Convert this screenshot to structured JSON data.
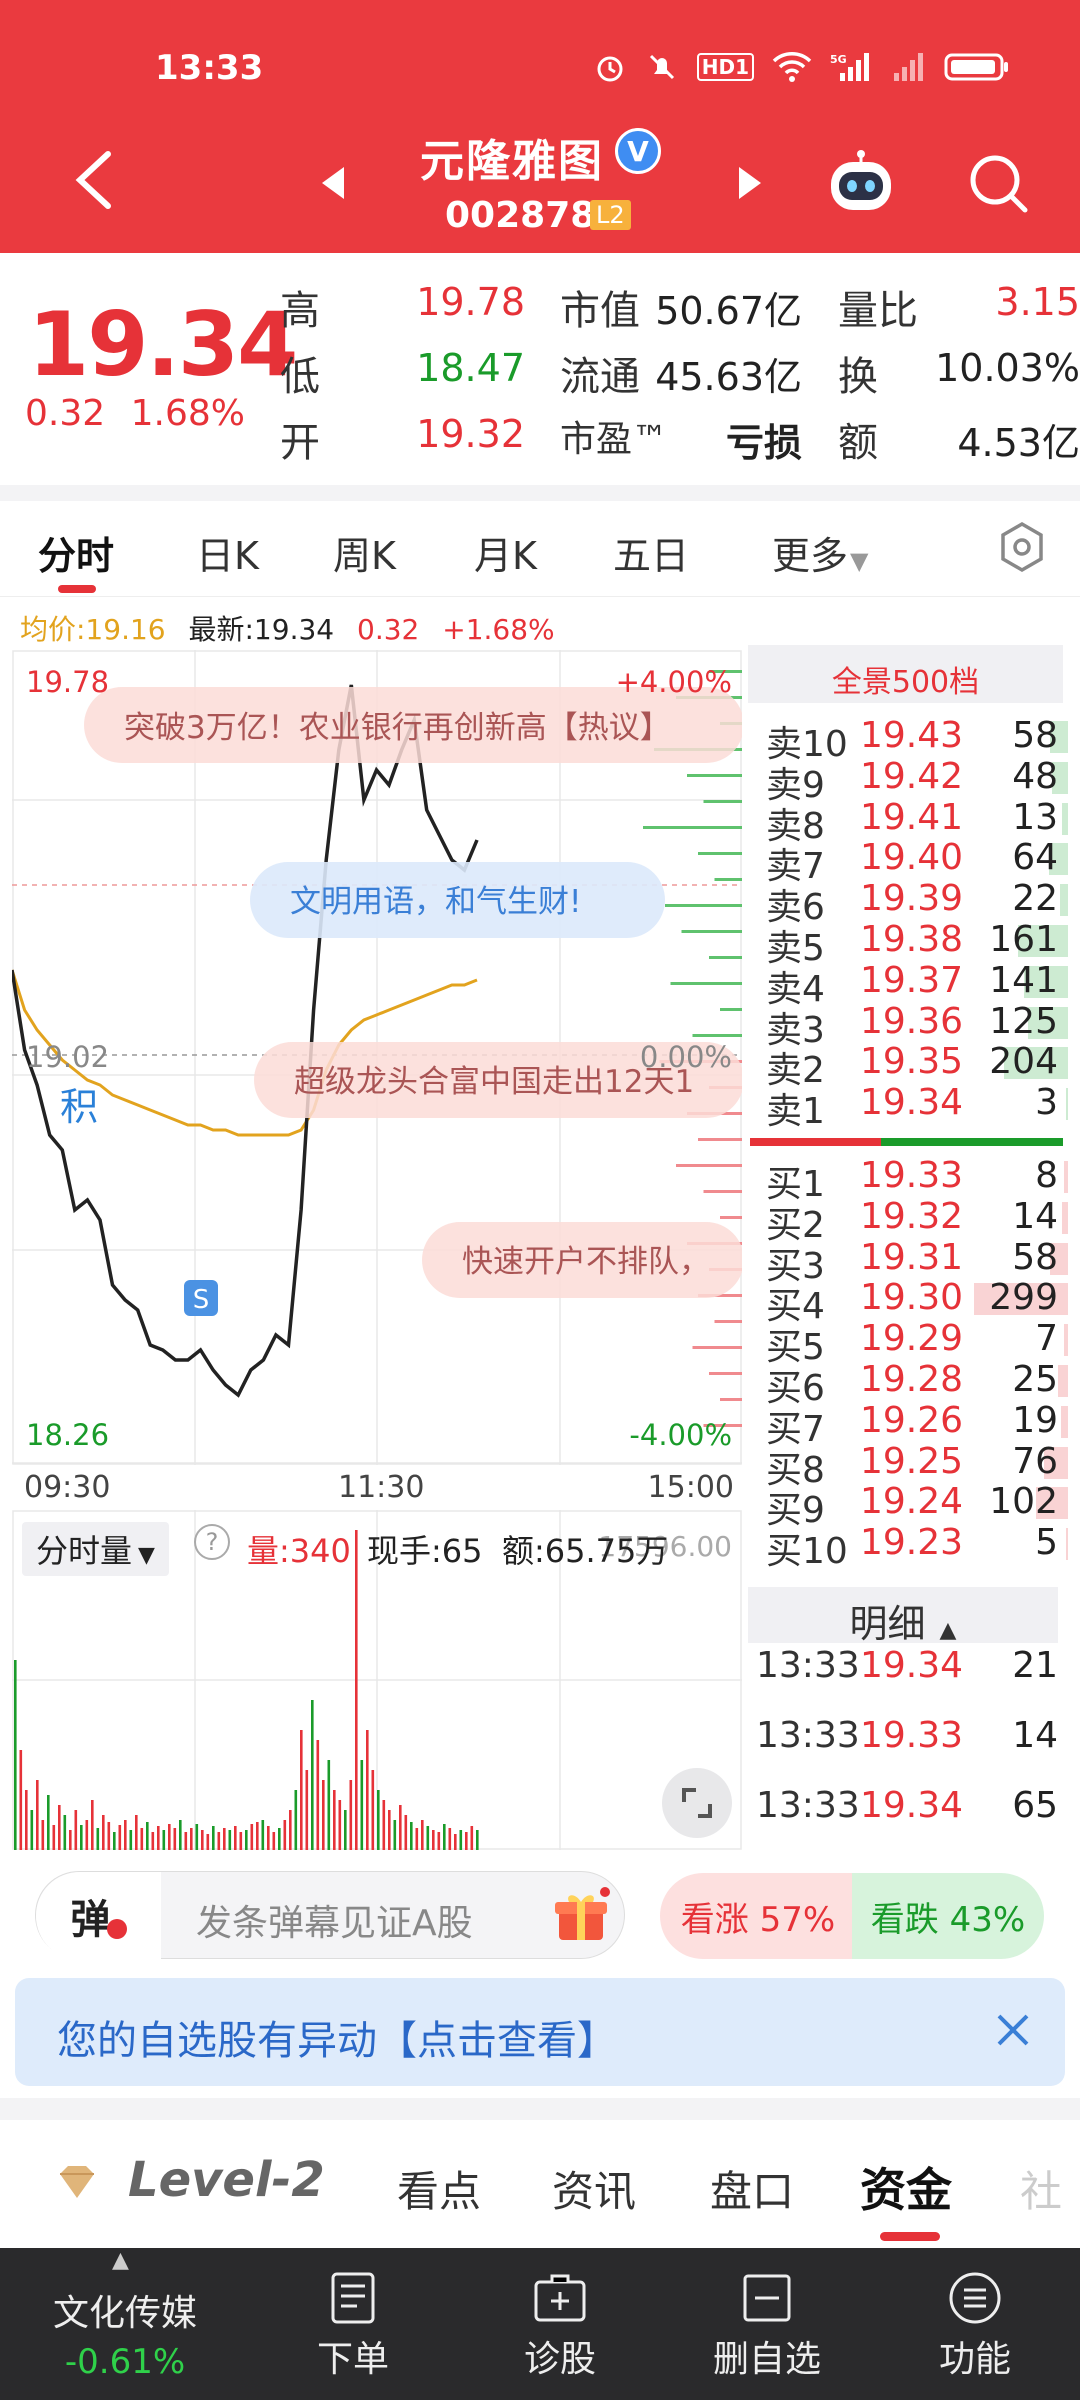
{
  "status_bar": {
    "time": "13:33",
    "hd_label": "HD1",
    "network": "5G"
  },
  "header": {
    "stock_name": "元隆雅图",
    "stock_code": "002878",
    "level_badge": "L2",
    "verified_mark": "V"
  },
  "quote": {
    "price": "19.34",
    "change": "0.32",
    "change_pct": "1.68%",
    "rows": [
      {
        "l1": "高",
        "v1": "19.78",
        "l2": "市值",
        "v2": "50.67亿",
        "l3": "量比",
        "v3": "3.15"
      },
      {
        "l1": "低",
        "v1": "18.47",
        "l2": "流通",
        "v2": "45.63亿",
        "l3": "换",
        "v3": "10.03%"
      },
      {
        "l1": "开",
        "v1": "19.32",
        "l2": "市盈™",
        "v2": "亏损",
        "l3": "额",
        "v3": "4.53亿"
      }
    ]
  },
  "tabs": [
    "分时",
    "日K",
    "周K",
    "月K",
    "五日",
    "更多"
  ],
  "info_line": {
    "avg_label": "均价:19.16",
    "latest_label": "最新:19.34",
    "change": "0.32",
    "change_pct": "+1.68%"
  },
  "chart": {
    "high_label": "19.78",
    "mid_label": "19.02",
    "low_label": "18.26",
    "pct_top": "+4.00%",
    "pct_mid": "0.00%",
    "pct_bottom": "-4.00%",
    "times": [
      "09:30",
      "11:30",
      "15:00"
    ],
    "marker_b": "积",
    "marker_s": "S",
    "danmu": [
      "突破3万亿！农业银行再创新高【热议】",
      "文明用语，和气生财!",
      "超级龙头合富中国走出12天1",
      "快速开户不排队，"
    ]
  },
  "chart_data": {
    "type": "line",
    "xlabel": "",
    "ylabel": "",
    "ylim": [
      18.26,
      19.78
    ],
    "series": [
      {
        "values": [
          19.18,
          19.02,
          18.95,
          18.85,
          18.82,
          18.7,
          18.72,
          18.68,
          18.55,
          18.52,
          18.5,
          18.43,
          18.42,
          18.4,
          18.4,
          18.42,
          18.38,
          18.35,
          18.33,
          18.38,
          18.4,
          18.45,
          18.43,
          18.7,
          19.1,
          19.4,
          19.62,
          19.75,
          19.52,
          19.58,
          19.55,
          19.62,
          19.68,
          19.5,
          19.45,
          19.4,
          19.38,
          19.44
        ]
      },
      {
        "values": [
          19.18,
          19.1,
          19.06,
          19.03,
          19.0,
          18.98,
          18.96,
          18.95,
          18.93,
          18.92,
          18.91,
          18.9,
          18.89,
          18.88,
          18.87,
          18.87,
          18.86,
          18.86,
          18.85,
          18.85,
          18.85,
          18.85,
          18.85,
          18.86,
          18.9,
          18.98,
          19.03,
          19.06,
          19.08,
          19.09,
          19.1,
          19.11,
          19.12,
          19.13,
          19.14,
          19.15,
          19.15,
          19.16
        ]
      }
    ]
  },
  "depth": {
    "title": "全景500档",
    "asks": [
      {
        "label": "卖10",
        "price": "19.43",
        "vol": "58",
        "bar": 0.15
      },
      {
        "label": "卖9",
        "price": "19.42",
        "vol": "48",
        "bar": 0.13
      },
      {
        "label": "卖8",
        "price": "19.41",
        "vol": "13",
        "bar": 0.05
      },
      {
        "label": "卖7",
        "price": "19.40",
        "vol": "64",
        "bar": 0.16
      },
      {
        "label": "卖6",
        "price": "19.39",
        "vol": "22",
        "bar": 0.07
      },
      {
        "label": "卖5",
        "price": "19.38",
        "vol": "161",
        "bar": 0.42
      },
      {
        "label": "卖4",
        "price": "19.37",
        "vol": "141",
        "bar": 0.37
      },
      {
        "label": "卖3",
        "price": "19.36",
        "vol": "125",
        "bar": 0.33
      },
      {
        "label": "卖2",
        "price": "19.35",
        "vol": "204",
        "bar": 0.53
      },
      {
        "label": "卖1",
        "price": "19.34",
        "vol": "3",
        "bar": 0.02
      }
    ],
    "bids": [
      {
        "label": "买1",
        "price": "19.33",
        "vol": "8",
        "bar": 0.03
      },
      {
        "label": "买2",
        "price": "19.32",
        "vol": "14",
        "bar": 0.05
      },
      {
        "label": "买3",
        "price": "19.31",
        "vol": "58",
        "bar": 0.15
      },
      {
        "label": "买4",
        "price": "19.30",
        "vol": "299",
        "bar": 0.78
      },
      {
        "label": "买5",
        "price": "19.29",
        "vol": "7",
        "bar": 0.03
      },
      {
        "label": "买6",
        "price": "19.28",
        "vol": "25",
        "bar": 0.08
      },
      {
        "label": "买7",
        "price": "19.26",
        "vol": "19",
        "bar": 0.06
      },
      {
        "label": "买8",
        "price": "19.25",
        "vol": "76",
        "bar": 0.2
      },
      {
        "label": "买9",
        "price": "19.24",
        "vol": "102",
        "bar": 0.27
      },
      {
        "label": "买10",
        "price": "19.23",
        "vol": "5",
        "bar": 0.02
      }
    ],
    "ask_ratio": 0.42,
    "tape_title": "明细",
    "tape": [
      {
        "time": "13:33",
        "price": "19.34",
        "vol": "21"
      },
      {
        "time": "13:33",
        "price": "19.33",
        "vol": "14"
      },
      {
        "time": "13:33",
        "price": "19.34",
        "vol": "65"
      }
    ]
  },
  "volume": {
    "selector": "分时量",
    "vol_label": "量:340",
    "hand_label": "现手:65",
    "amount_label": "额:65.75万",
    "axis_max": "17596.00"
  },
  "danmu_bar": {
    "toggle": "弹",
    "placeholder": "发条弹幕见证A股",
    "bull": "看涨 57%",
    "bear": "看跌 43%"
  },
  "alert": {
    "text": "您的自选股有异动【点击查看】"
  },
  "bottom_tabs": [
    "Level-2",
    "看点",
    "资讯",
    "盘口",
    "资金",
    "社"
  ],
  "nav": {
    "sector_name": "文化传媒",
    "sector_change": "-0.61%",
    "items": [
      "下单",
      "诊股",
      "删自选",
      "功能"
    ]
  },
  "colors": {
    "up": "#e63238",
    "down": "#1a9b2a",
    "header": "#ea3a3f",
    "avg_line": "#e2a31e"
  }
}
